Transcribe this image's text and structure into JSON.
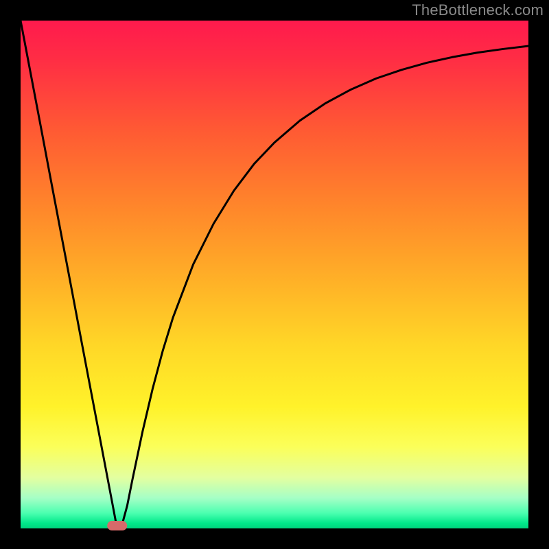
{
  "watermark": "TheBottleneck.com",
  "chart_data": {
    "type": "line",
    "title": "",
    "xlabel": "",
    "ylabel": "",
    "xlim": [
      0,
      100
    ],
    "ylim": [
      0,
      100
    ],
    "grid": false,
    "series": [
      {
        "name": "curve",
        "color": "#000000",
        "x": [
          0,
          2,
          4,
          6,
          8,
          10,
          12,
          14,
          16,
          18,
          19,
          20,
          21,
          22,
          24,
          26,
          28,
          30,
          34,
          38,
          42,
          46,
          50,
          55,
          60,
          65,
          70,
          75,
          80,
          85,
          90,
          95,
          100
        ],
        "y": [
          100,
          89.5,
          79,
          68.4,
          57.9,
          47.4,
          36.8,
          26.3,
          15.8,
          5.3,
          0,
          0.8,
          4.5,
          9.5,
          19,
          27.5,
          35,
          41.5,
          52,
          60,
          66.5,
          71.8,
          76,
          80.3,
          83.7,
          86.4,
          88.6,
          90.3,
          91.7,
          92.8,
          93.7,
          94.4,
          95
        ]
      }
    ],
    "marker": {
      "x": 19,
      "y": 0,
      "width": 4,
      "color": "#d66a6a"
    }
  }
}
